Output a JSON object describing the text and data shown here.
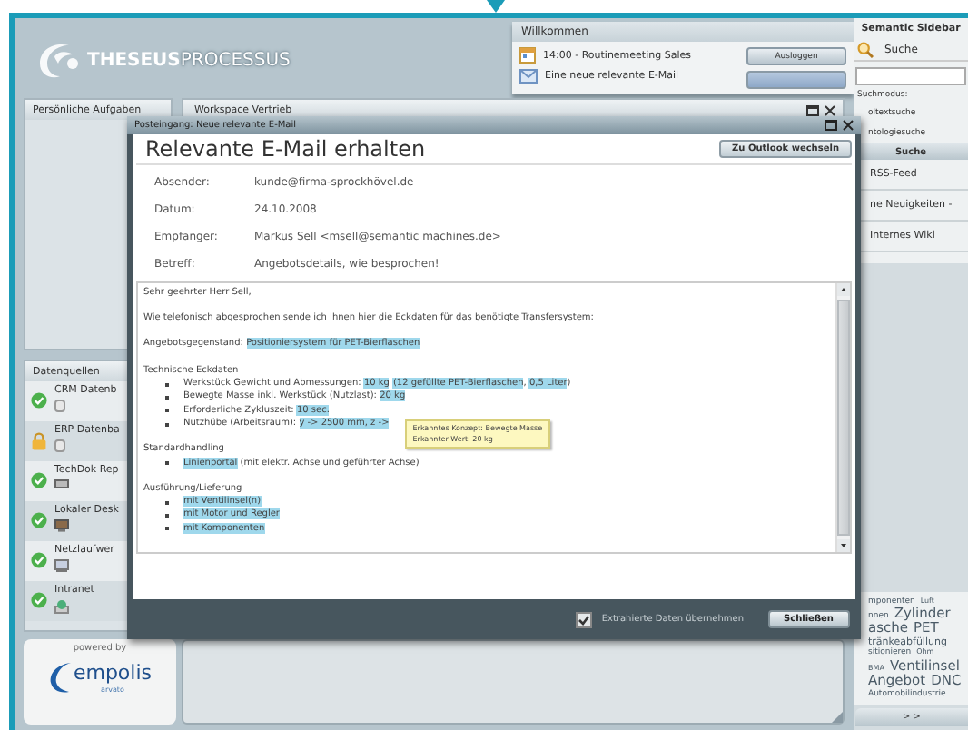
{
  "logo": {
    "bold": "THESEUS",
    "light": "PROCESSUS"
  },
  "welcome": {
    "title": "Willkommen",
    "entries": [
      {
        "kind": "calendar",
        "text": "14:00 - Routinemeeting Sales"
      },
      {
        "kind": "mail",
        "text": "Eine neue relevante E-Mail"
      }
    ],
    "logout_button": "Ausloggen"
  },
  "tasks_panel": {
    "title": "Persönliche Aufgaben"
  },
  "workspace": {
    "title": "Workspace Vertrieb"
  },
  "datasources": {
    "title": "Datenquellen",
    "items": [
      {
        "label": "CRM Datenb",
        "kind": "ok"
      },
      {
        "label": "ERP Datenba",
        "kind": "locked"
      },
      {
        "label": "TechDok Rep",
        "kind": "ok"
      },
      {
        "label": "Lokaler Desk",
        "kind": "ok"
      },
      {
        "label": "Netzlaufwer",
        "kind": "ok"
      },
      {
        "label": "Intranet",
        "kind": "ok"
      }
    ]
  },
  "powered": {
    "caption": "powered by",
    "brand": "empolis",
    "sub": "arvato"
  },
  "sidebar": {
    "title": "Semantic Sidebar",
    "search_label": "Suche",
    "mode_label": "Suchmodus:",
    "modes": [
      "oltextsuche",
      "ntologiesuche"
    ],
    "search_button": "Suche",
    "links": [
      "RSS-Feed",
      "ne Neuigkeiten -",
      "Internes Wiki"
    ],
    "tag_rows": [
      [
        {
          "text": "mponenten",
          "kind": "small"
        },
        {
          "text": "Luft",
          "kind": "tiny"
        }
      ],
      [
        {
          "text": "nnen",
          "kind": "small"
        },
        {
          "text": "Zylinder",
          "kind": "large"
        }
      ],
      [
        {
          "text": "asche",
          "kind": "large"
        },
        {
          "text": "PET",
          "kind": "large"
        }
      ],
      [
        {
          "text": "tränkeabfüllung",
          "kind": "medium"
        }
      ],
      [
        {
          "text": "sitionieren",
          "kind": "small"
        },
        {
          "text": "Ohm",
          "kind": "tiny"
        }
      ],
      [
        {
          "text": "BMA",
          "kind": "tiny"
        },
        {
          "text": "Ventilinsel",
          "kind": "large"
        }
      ],
      [
        {
          "text": "Angebot",
          "kind": "large"
        },
        {
          "text": "DNC",
          "kind": "large"
        }
      ],
      [
        {
          "text": "Automobilindustrie",
          "kind": "small"
        }
      ]
    ],
    "more_button": "> >"
  },
  "dialog": {
    "title": "Posteingang: Neue relevante E-Mail",
    "heading": "Relevante E-Mail erhalten",
    "outlook_button": "Zu Outlook wechseln",
    "fields": [
      {
        "label": "Absender:",
        "value": "kunde@firma-sprockhövel.de"
      },
      {
        "label": "Datum:",
        "value": "24.10.2008"
      },
      {
        "label": "Empfänger:",
        "value": "Markus Sell <msell@semantic machines.de>"
      },
      {
        "label": "Betreff:",
        "value": "Angebotsdetails, wie besprochen!"
      }
    ],
    "email": {
      "blocks": [
        {
          "kind": "paragraph",
          "segments": [
            {
              "text": "Sehr geehrter Herr Sell,",
              "highlighted": false
            }
          ]
        },
        {
          "kind": "paragraph",
          "segments": [
            {
              "text": "Wie telefonisch abgesprochen sende ich Ihnen hier die Eckdaten für das benötigte Transfersystem:",
              "highlighted": false
            }
          ]
        },
        {
          "kind": "paragraph",
          "segments": [
            {
              "text": "Angebotsgegenstand: ",
              "highlighted": false
            },
            {
              "text": "Positioniersystem für PET-Bierflaschen",
              "highlighted": true
            }
          ]
        },
        {
          "kind": "section",
          "heading": "Technische Eckdaten",
          "items": [
            {
              "segments": [
                {
                  "text": "Werkstück Gewicht und Abmessungen: ",
                  "highlighted": false
                },
                {
                  "text": "10 kg",
                  "highlighted": true
                },
                {
                  "text": "(12 gefüllte PET-Bierflaschen",
                  "highlighted": true
                },
                {
                  "text": ", ",
                  "highlighted": false
                },
                {
                  "text": "0,5 Liter",
                  "highlighted": true
                },
                {
                  "text": ")",
                  "highlighted": false
                }
              ]
            },
            {
              "segments": [
                {
                  "text": "Bewegte Masse inkl. Werkstück (Nutzlast): ",
                  "highlighted": false
                },
                {
                  "text": "20 kg",
                  "highlighted": true
                }
              ]
            },
            {
              "segments": [
                {
                  "text": "Erforderliche Zykluszeit: ",
                  "highlighted": false
                },
                {
                  "text": "10 sec.",
                  "highlighted": true
                }
              ]
            },
            {
              "segments": [
                {
                  "text": "Nutzhübe (Arbeitsraum): ",
                  "highlighted": false
                },
                {
                  "text": "y -> 2500 mm, z ->",
                  "highlighted": true
                }
              ],
              "tooltip": [
                "Erkanntes Konzept: Bewegte Masse",
                "Erkannter Wert: 20 kg"
              ]
            }
          ]
        },
        {
          "kind": "section",
          "heading": "Standardhandling",
          "items": [
            {
              "segments": [
                {
                  "text": "Linienportal",
                  "highlighted": true
                },
                {
                  "text": " (mit elektr. Achse und geführter Achse)",
                  "highlighted": false
                }
              ]
            }
          ]
        },
        {
          "kind": "section",
          "heading": "Ausführung/Lieferung",
          "items": [
            {
              "segments": [
                {
                  "text": "mit Ventilinsel(n)",
                  "highlighted": true
                }
              ]
            },
            {
              "segments": [
                {
                  "text": "mit Motor und Regler",
                  "highlighted": true
                }
              ]
            },
            {
              "segments": [
                {
                  "text": "mit Komponenten",
                  "highlighted": true
                }
              ]
            }
          ]
        }
      ]
    },
    "adopt": {
      "label": "Extrahierte Daten übernehmen",
      "checked": true
    },
    "close_button": "Schließen"
  }
}
